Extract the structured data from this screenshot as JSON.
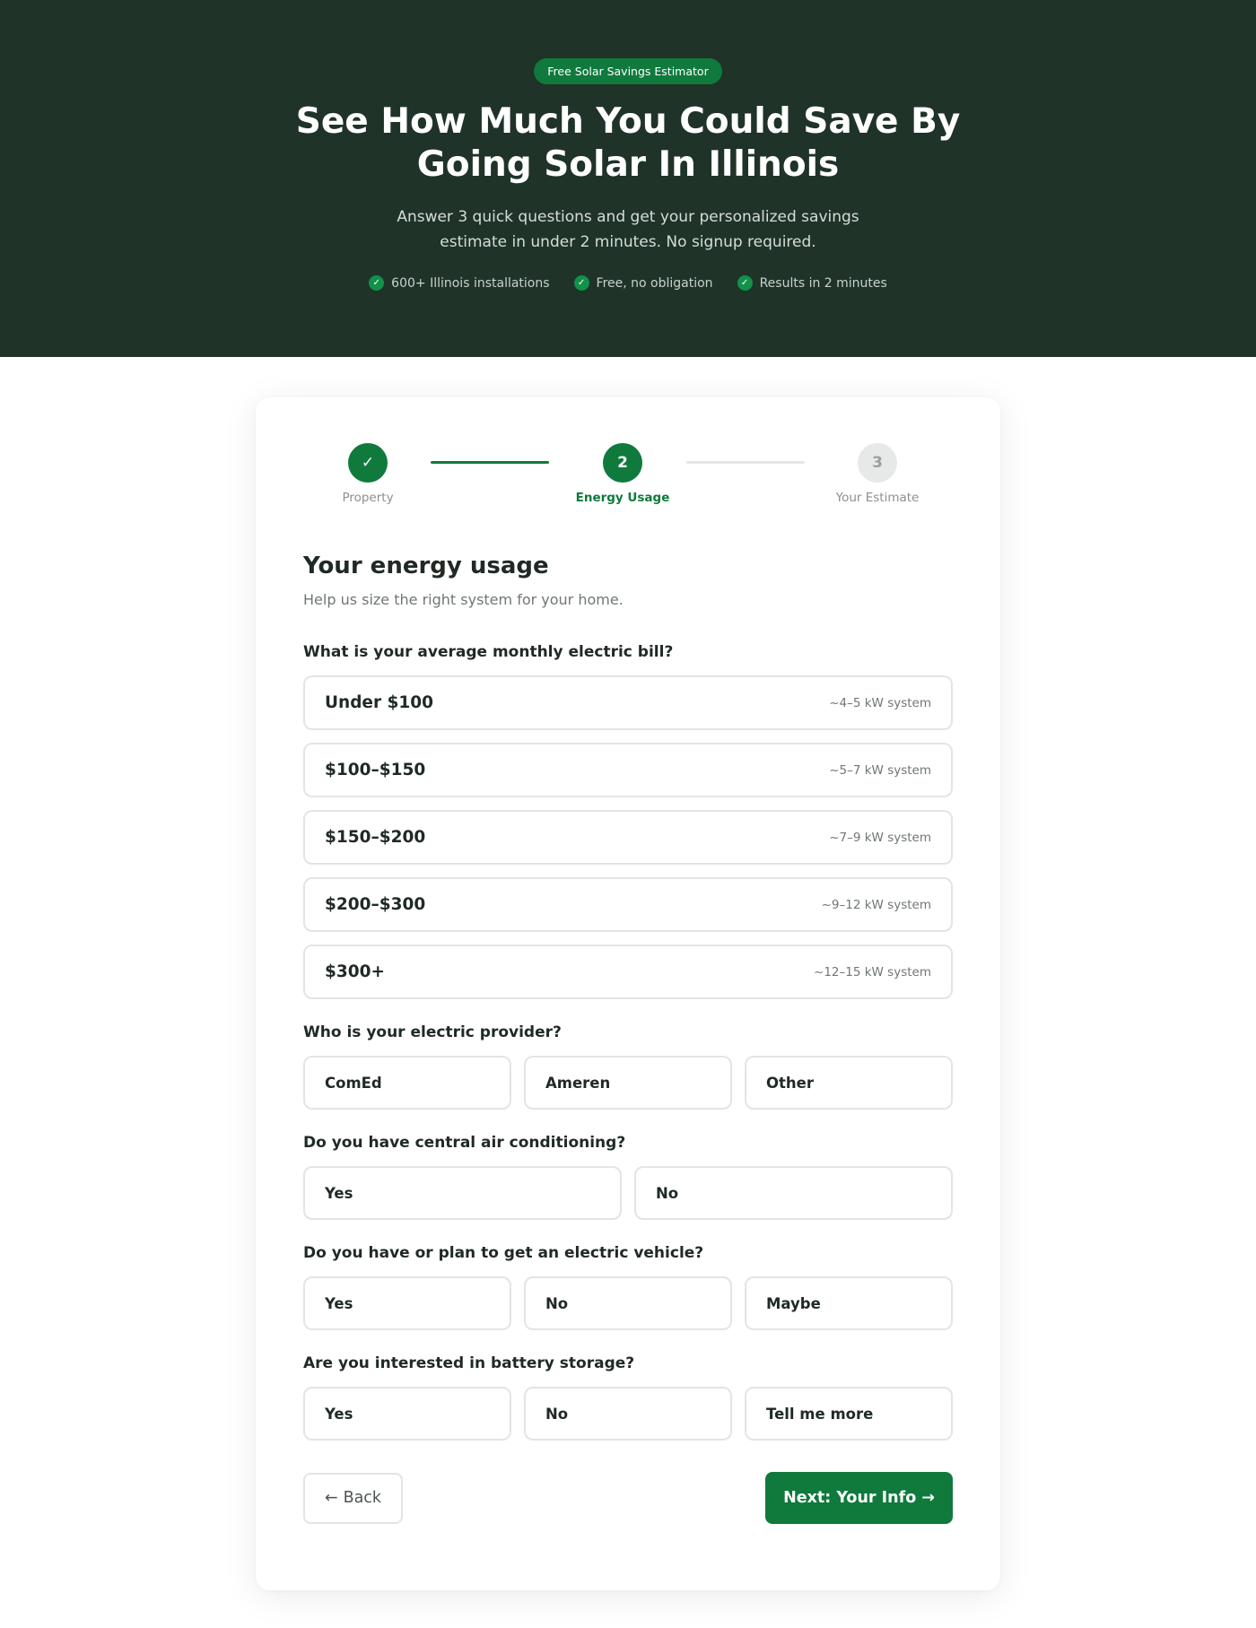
{
  "hero": {
    "badge": "Free Solar Savings Estimator",
    "title": "See How Much You Could Save By Going Solar In Illinois",
    "subtitle": "Answer 3 quick questions and get your personalized savings estimate in under 2 minutes. No signup required.",
    "checks": [
      "600+ Illinois installations",
      "Free, no obligation",
      "Results in 2 minutes"
    ]
  },
  "stepper": {
    "steps": [
      {
        "label": "Property",
        "marker": "✓",
        "state": "done"
      },
      {
        "label": "Energy Usage",
        "marker": "2",
        "state": "active"
      },
      {
        "label": "Your Estimate",
        "marker": "3",
        "state": "todo"
      }
    ]
  },
  "section": {
    "title": "Your energy usage",
    "subtitle": "Help us size the right system for your home."
  },
  "bill": {
    "question": "What is your average monthly electric bill?",
    "options": [
      {
        "amount": "Under $100",
        "size": "~4–5 kW system"
      },
      {
        "amount": "$100–$150",
        "size": "~5–7 kW system"
      },
      {
        "amount": "$150–$200",
        "size": "~7–9 kW system"
      },
      {
        "amount": "$200–$300",
        "size": "~9–12 kW system"
      },
      {
        "amount": "$300+",
        "size": "~12–15 kW system"
      }
    ]
  },
  "provider": {
    "question": "Who is your electric provider?",
    "options": [
      "ComEd",
      "Ameren",
      "Other"
    ]
  },
  "ac": {
    "question": "Do you have central air conditioning?",
    "options": [
      "Yes",
      "No"
    ]
  },
  "ev": {
    "question": "Do you have or plan to get an electric vehicle?",
    "options": [
      "Yes",
      "No",
      "Maybe"
    ]
  },
  "battery": {
    "question": "Are you interested in battery storage?",
    "options": [
      "Yes",
      "No",
      "Tell me more"
    ]
  },
  "nav": {
    "back_arrow": "←",
    "back_label": "Back",
    "next_label": "Next: Your Info",
    "next_arrow": "→"
  },
  "colors": {
    "hero_bg": "#1f3329",
    "accent": "#0f7a3c",
    "border": "#e2e5e3"
  }
}
